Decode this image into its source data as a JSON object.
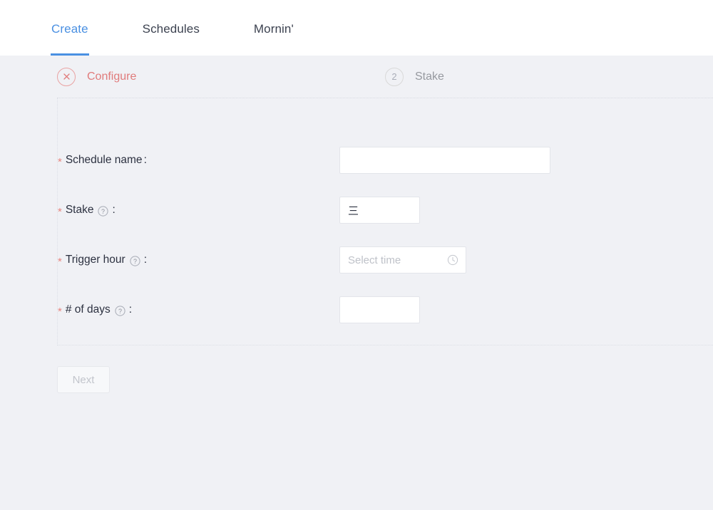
{
  "nav": {
    "tabs": [
      {
        "label": "Create",
        "active": true
      },
      {
        "label": "Schedules",
        "active": false
      },
      {
        "label": "Mornin'",
        "active": false
      }
    ]
  },
  "steps": [
    {
      "index": "1",
      "label": "Configure",
      "state": "error",
      "icon": "close-icon"
    },
    {
      "index": "2",
      "label": "Stake",
      "state": "pending",
      "icon": "number"
    }
  ],
  "form": {
    "fields": [
      {
        "label": "Schedule name",
        "required_marker": "*",
        "colon": ":",
        "has_help": false,
        "value": "",
        "placeholder": "",
        "control": "text"
      },
      {
        "label": "Stake",
        "required_marker": "*",
        "colon": ":",
        "has_help": true,
        "help_icon": "question-circle-icon",
        "value": "三",
        "placeholder": "",
        "control": "text-small"
      },
      {
        "label": "Trigger hour",
        "required_marker": "*",
        "colon": ":",
        "has_help": true,
        "help_icon": "question-circle-icon",
        "value": "",
        "placeholder": "Select time",
        "control": "time",
        "suffix_icon": "clock-icon"
      },
      {
        "label": "# of days",
        "required_marker": "*",
        "colon": ":",
        "has_help": true,
        "help_icon": "question-circle-icon",
        "value": "",
        "placeholder": "",
        "control": "text-small"
      }
    ]
  },
  "footer": {
    "next_label": "Next",
    "next_disabled": true
  },
  "colors": {
    "accent": "#4a90e2",
    "error": "#e07b7b",
    "page_bg": "#f0f1f5",
    "panel_bg": "#ffffff",
    "muted_text": "#96999f",
    "label_text": "#2c3140"
  }
}
